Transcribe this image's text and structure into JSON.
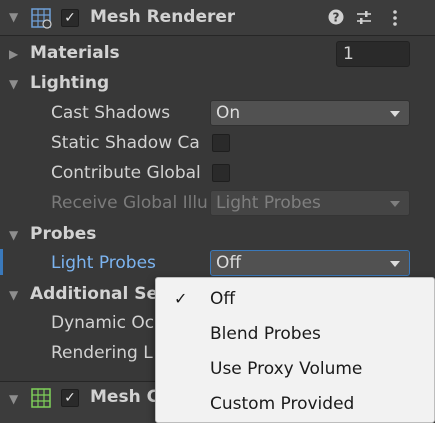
{
  "component": {
    "title": "Mesh Renderer",
    "enabled_check": "✓",
    "icons": [
      "mesh-renderer-icon",
      "help-icon",
      "presets-icon",
      "more-menu-icon"
    ]
  },
  "materials": {
    "label": "Materials",
    "count": "1"
  },
  "lighting": {
    "header": "Lighting",
    "cast_shadows_label": "Cast Shadows",
    "cast_shadows_value": "On",
    "static_shadow_label": "Static Shadow Ca",
    "contribute_gi_label": "Contribute Global",
    "receive_gi_label": "Receive Global Illu",
    "receive_gi_value": "Light Probes"
  },
  "probes": {
    "header": "Probes",
    "light_probes_label": "Light Probes",
    "light_probes_value": "Off"
  },
  "additional": {
    "header": "Additional Set",
    "dynamic_label": "Dynamic Oc",
    "rendering_label": "Rendering L"
  },
  "next_component": {
    "title": "Mesh C",
    "enabled_check": "✓"
  },
  "dropdown_menu": {
    "selected_check": "✓",
    "items": [
      "Off",
      "Blend Probes",
      "Use Proxy Volume",
      "Custom Provided"
    ]
  },
  "colors": {
    "panel_bg": "#383838",
    "accent_blue": "#7cb4f0",
    "menu_bg": "#f2f2f2"
  }
}
